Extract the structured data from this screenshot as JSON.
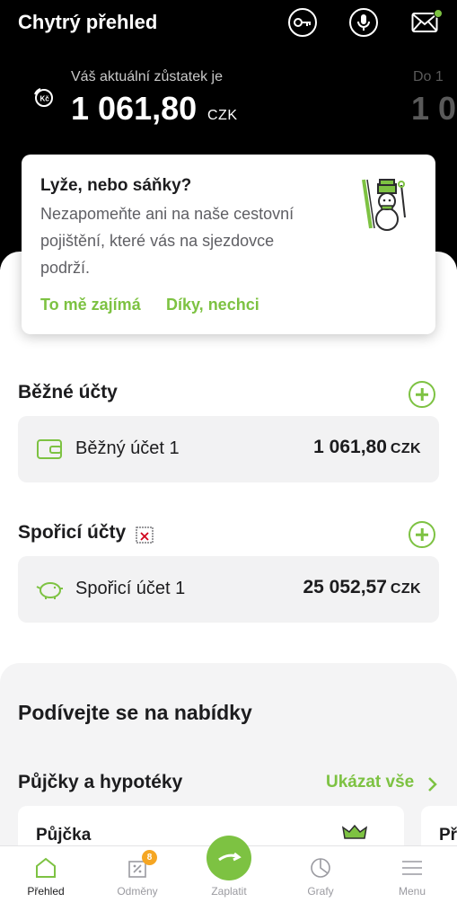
{
  "header": {
    "title": "Chytrý přehled",
    "icons": [
      "key-icon",
      "microphone-icon",
      "mail-icon"
    ]
  },
  "balance": {
    "label": "Váš aktuální zůstatek je",
    "value": "1 061,80",
    "currency": "CZK",
    "peek_label": "Do 1",
    "peek_value": "1 0"
  },
  "promo": {
    "title": "Lyže, nebo sáňky?",
    "text": "Nezapomeňte ani na naše cestovní pojištění, které vás na sjezdovce podrží.",
    "accept": "To mě zajímá",
    "decline": "Díky, nechci"
  },
  "current_accounts": {
    "title": "Běžné účty",
    "items": [
      {
        "name": "Běžný účet 1",
        "amount": "1 061,80",
        "currency": "CZK"
      }
    ]
  },
  "savings_accounts": {
    "title": "Spořicí účty",
    "items": [
      {
        "name": "Spořicí účet 1",
        "amount": "25 052,57",
        "currency": "CZK"
      }
    ]
  },
  "offers": {
    "title": "Podívejte se na nabídky",
    "loans_title": "Půjčky a hypotéky",
    "show_all": "Ukázat vše",
    "cards": [
      "Půjčka",
      "Př"
    ]
  },
  "tabbar": {
    "items": [
      {
        "label": "Přehled",
        "icon": "home-icon"
      },
      {
        "label": "Odměny",
        "icon": "coupon-icon",
        "badge": "8"
      },
      {
        "label": "Zaplatit",
        "icon": "pay-arrow-icon"
      },
      {
        "label": "Grafy",
        "icon": "pie-chart-icon"
      },
      {
        "label": "Menu",
        "icon": "hamburger-icon"
      }
    ]
  },
  "colors": {
    "accent": "#7dc242",
    "header_bg": "#000000",
    "badge": "#f5a623"
  }
}
